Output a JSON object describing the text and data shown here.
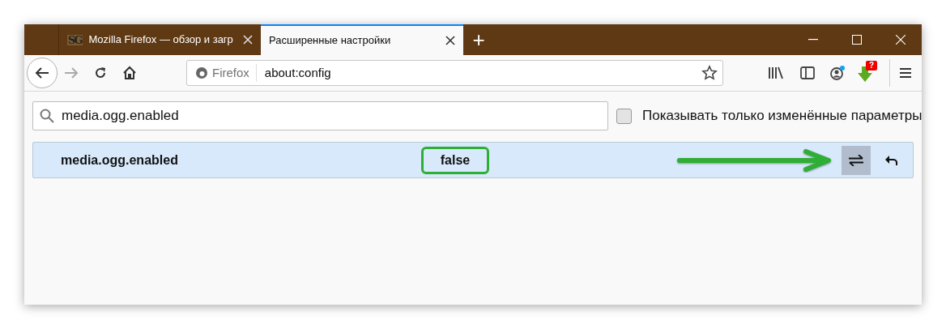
{
  "tabs": [
    {
      "title": "Mozilla Firefox — обзор и загр",
      "favicon": "SG",
      "selected": false
    },
    {
      "title": "Расширенные настройки",
      "selected": true
    }
  ],
  "new_tab": "+",
  "toolbar": {
    "identity": "Firefox",
    "url": "about:config",
    "download_badge": "?"
  },
  "search": {
    "value": "media.ogg.enabled"
  },
  "modified_only": {
    "label": "Показывать только изменённые параметры",
    "checked": false
  },
  "preferences": [
    {
      "name": "media.ogg.enabled",
      "value": "false",
      "selected": true
    }
  ]
}
